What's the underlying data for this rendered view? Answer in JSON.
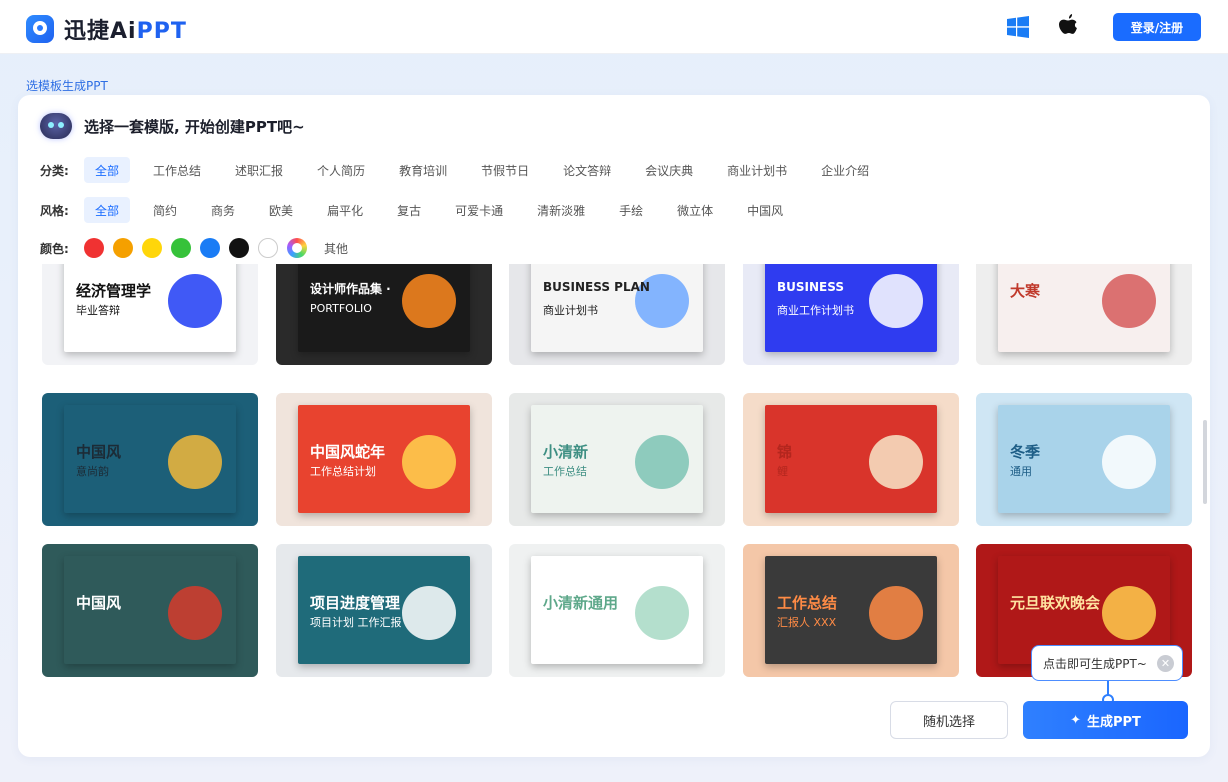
{
  "header": {
    "logo_text": "迅捷Ai",
    "logo_ppt": "PPT",
    "login_label": "登录/注册"
  },
  "breadcrumb": "选模板生成PPT",
  "panel": {
    "title": "选择一套模版, 开始创建PPT吧~"
  },
  "filters": {
    "category_label": "分类:",
    "categories": [
      "全部",
      "工作总结",
      "述职汇报",
      "个人简历",
      "教育培训",
      "节假节日",
      "论文答辩",
      "会议庆典",
      "商业计划书",
      "企业介绍"
    ],
    "style_label": "风格:",
    "styles": [
      "全部",
      "简约",
      "商务",
      "欧美",
      "扁平化",
      "复古",
      "可爱卡通",
      "清新淡雅",
      "手绘",
      "微立体",
      "中国风"
    ],
    "color_label": "颜色:",
    "colors": [
      "#f03232",
      "#f5a000",
      "#ffd60a",
      "#36c23a",
      "#1a7cf5",
      "#111111",
      "#ffffff"
    ],
    "other_label": "其他"
  },
  "templates": [
    {
      "title": "经济管理学",
      "subtitle": "毕业答辩",
      "bg": "#ffffff",
      "fg": "#111111",
      "accent": "#1f3cf5",
      "frame": "#f2f3f6"
    },
    {
      "title": "设计师作品集 ·",
      "subtitle": "PORTFOLIO",
      "bg": "#1a1a1a",
      "fg": "#ffffff",
      "accent": "#ff8a1e",
      "frame": "#2a2a2a"
    },
    {
      "title": "BUSINESS PLAN",
      "subtitle": "商业计划书",
      "bg": "#f5f5f5",
      "fg": "#222222",
      "accent": "#6fa8ff",
      "frame": "#e6e7ea"
    },
    {
      "title": "BUSINESS",
      "subtitle": "商业工作计划书",
      "bg": "#2f3cf0",
      "fg": "#ffffff",
      "accent": "#ffffff",
      "frame": "#e8eaf6"
    },
    {
      "title": "大寒",
      "subtitle": "",
      "bg": "#f7efee",
      "fg": "#c0392b",
      "accent": "#d65a5a",
      "frame": "#eeeeee"
    },
    {
      "title": "中国风",
      "subtitle": "意尚韵",
      "bg": "#1c5f78",
      "fg": "#1c2b36",
      "accent": "#f2b83a",
      "frame": "#1c5f78"
    },
    {
      "title": "中国风蛇年",
      "subtitle": "工作总结计划",
      "bg": "#e8432f",
      "fg": "#ffffff",
      "accent": "#ffd24d",
      "frame": "#f0e4dc"
    },
    {
      "title": "小清新",
      "subtitle": "工作总结",
      "bg": "#eef3ef",
      "fg": "#3e8f83",
      "accent": "#7dc3b4",
      "frame": "#e7e9e8"
    },
    {
      "title": "锦",
      "subtitle": "鲤",
      "bg": "#d9342b",
      "fg": "#b3261e",
      "accent": "#f7e6c8",
      "frame": "#f5dcc9"
    },
    {
      "title": "冬季",
      "subtitle": "通用",
      "bg": "#a9d3ea",
      "fg": "#1d5d86",
      "accent": "#ffffff",
      "frame": "#cfe6f4"
    },
    {
      "title": "中国风",
      "subtitle": "",
      "bg": "#2f5a5a",
      "fg": "#ffffff",
      "accent": "#d63b2b",
      "frame": "#2f5a5a"
    },
    {
      "title": "项目进度管理",
      "subtitle": "项目计划 工作汇报",
      "bg": "#1f6b7a",
      "fg": "#ffffff",
      "accent": "#ffffff",
      "frame": "#e6e9ec"
    },
    {
      "title": "小清新通用",
      "subtitle": "",
      "bg": "#ffffff",
      "fg": "#5ea88a",
      "accent": "#a7d9c4",
      "frame": "#eff1f1"
    },
    {
      "title": "工作总结",
      "subtitle": "汇报人 XXX",
      "bg": "#3a3a3a",
      "fg": "#ff8b45",
      "accent": "#ff8b45",
      "frame": "#f4c7a8"
    },
    {
      "title": "元旦联欢晚会",
      "subtitle": "",
      "bg": "#b01818",
      "fg": "#ffe3a0",
      "accent": "#ffcc4d",
      "frame": "#b01818"
    }
  ],
  "actions": {
    "random_label": "随机选择",
    "generate_label": "生成PPT",
    "tooltip": "点击即可生成PPT~"
  }
}
